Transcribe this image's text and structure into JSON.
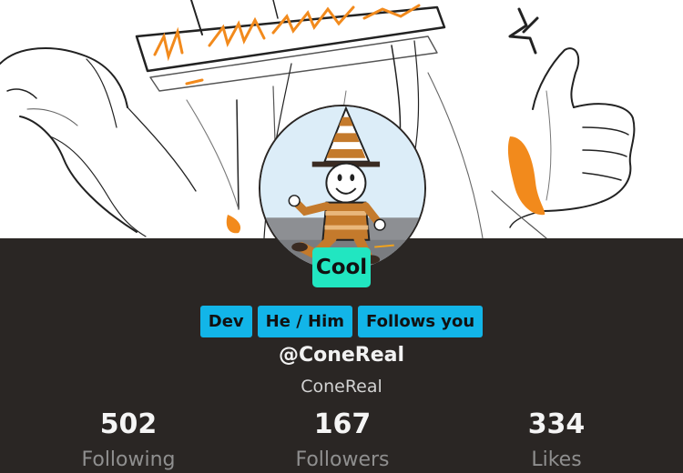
{
  "profile": {
    "badge": "Cool",
    "tags": [
      {
        "label": "Dev"
      },
      {
        "label": "He / Him"
      },
      {
        "label": "Follows you"
      }
    ],
    "handle": "@ConeReal",
    "display_name": "ConeReal"
  },
  "stats": {
    "following": {
      "value": "502",
      "label": "Following"
    },
    "followers": {
      "value": "167",
      "label": "Followers"
    },
    "likes": {
      "value": "334",
      "label": "Likes"
    }
  },
  "colors": {
    "panel_bg": "#2a2624",
    "badge_bg": "#21e6c1",
    "tag_bg": "#12b5e8",
    "accent_orange": "#f28a1c"
  },
  "icons": {
    "banner": "banner-sketch-image",
    "avatar": "cone-character-avatar"
  }
}
